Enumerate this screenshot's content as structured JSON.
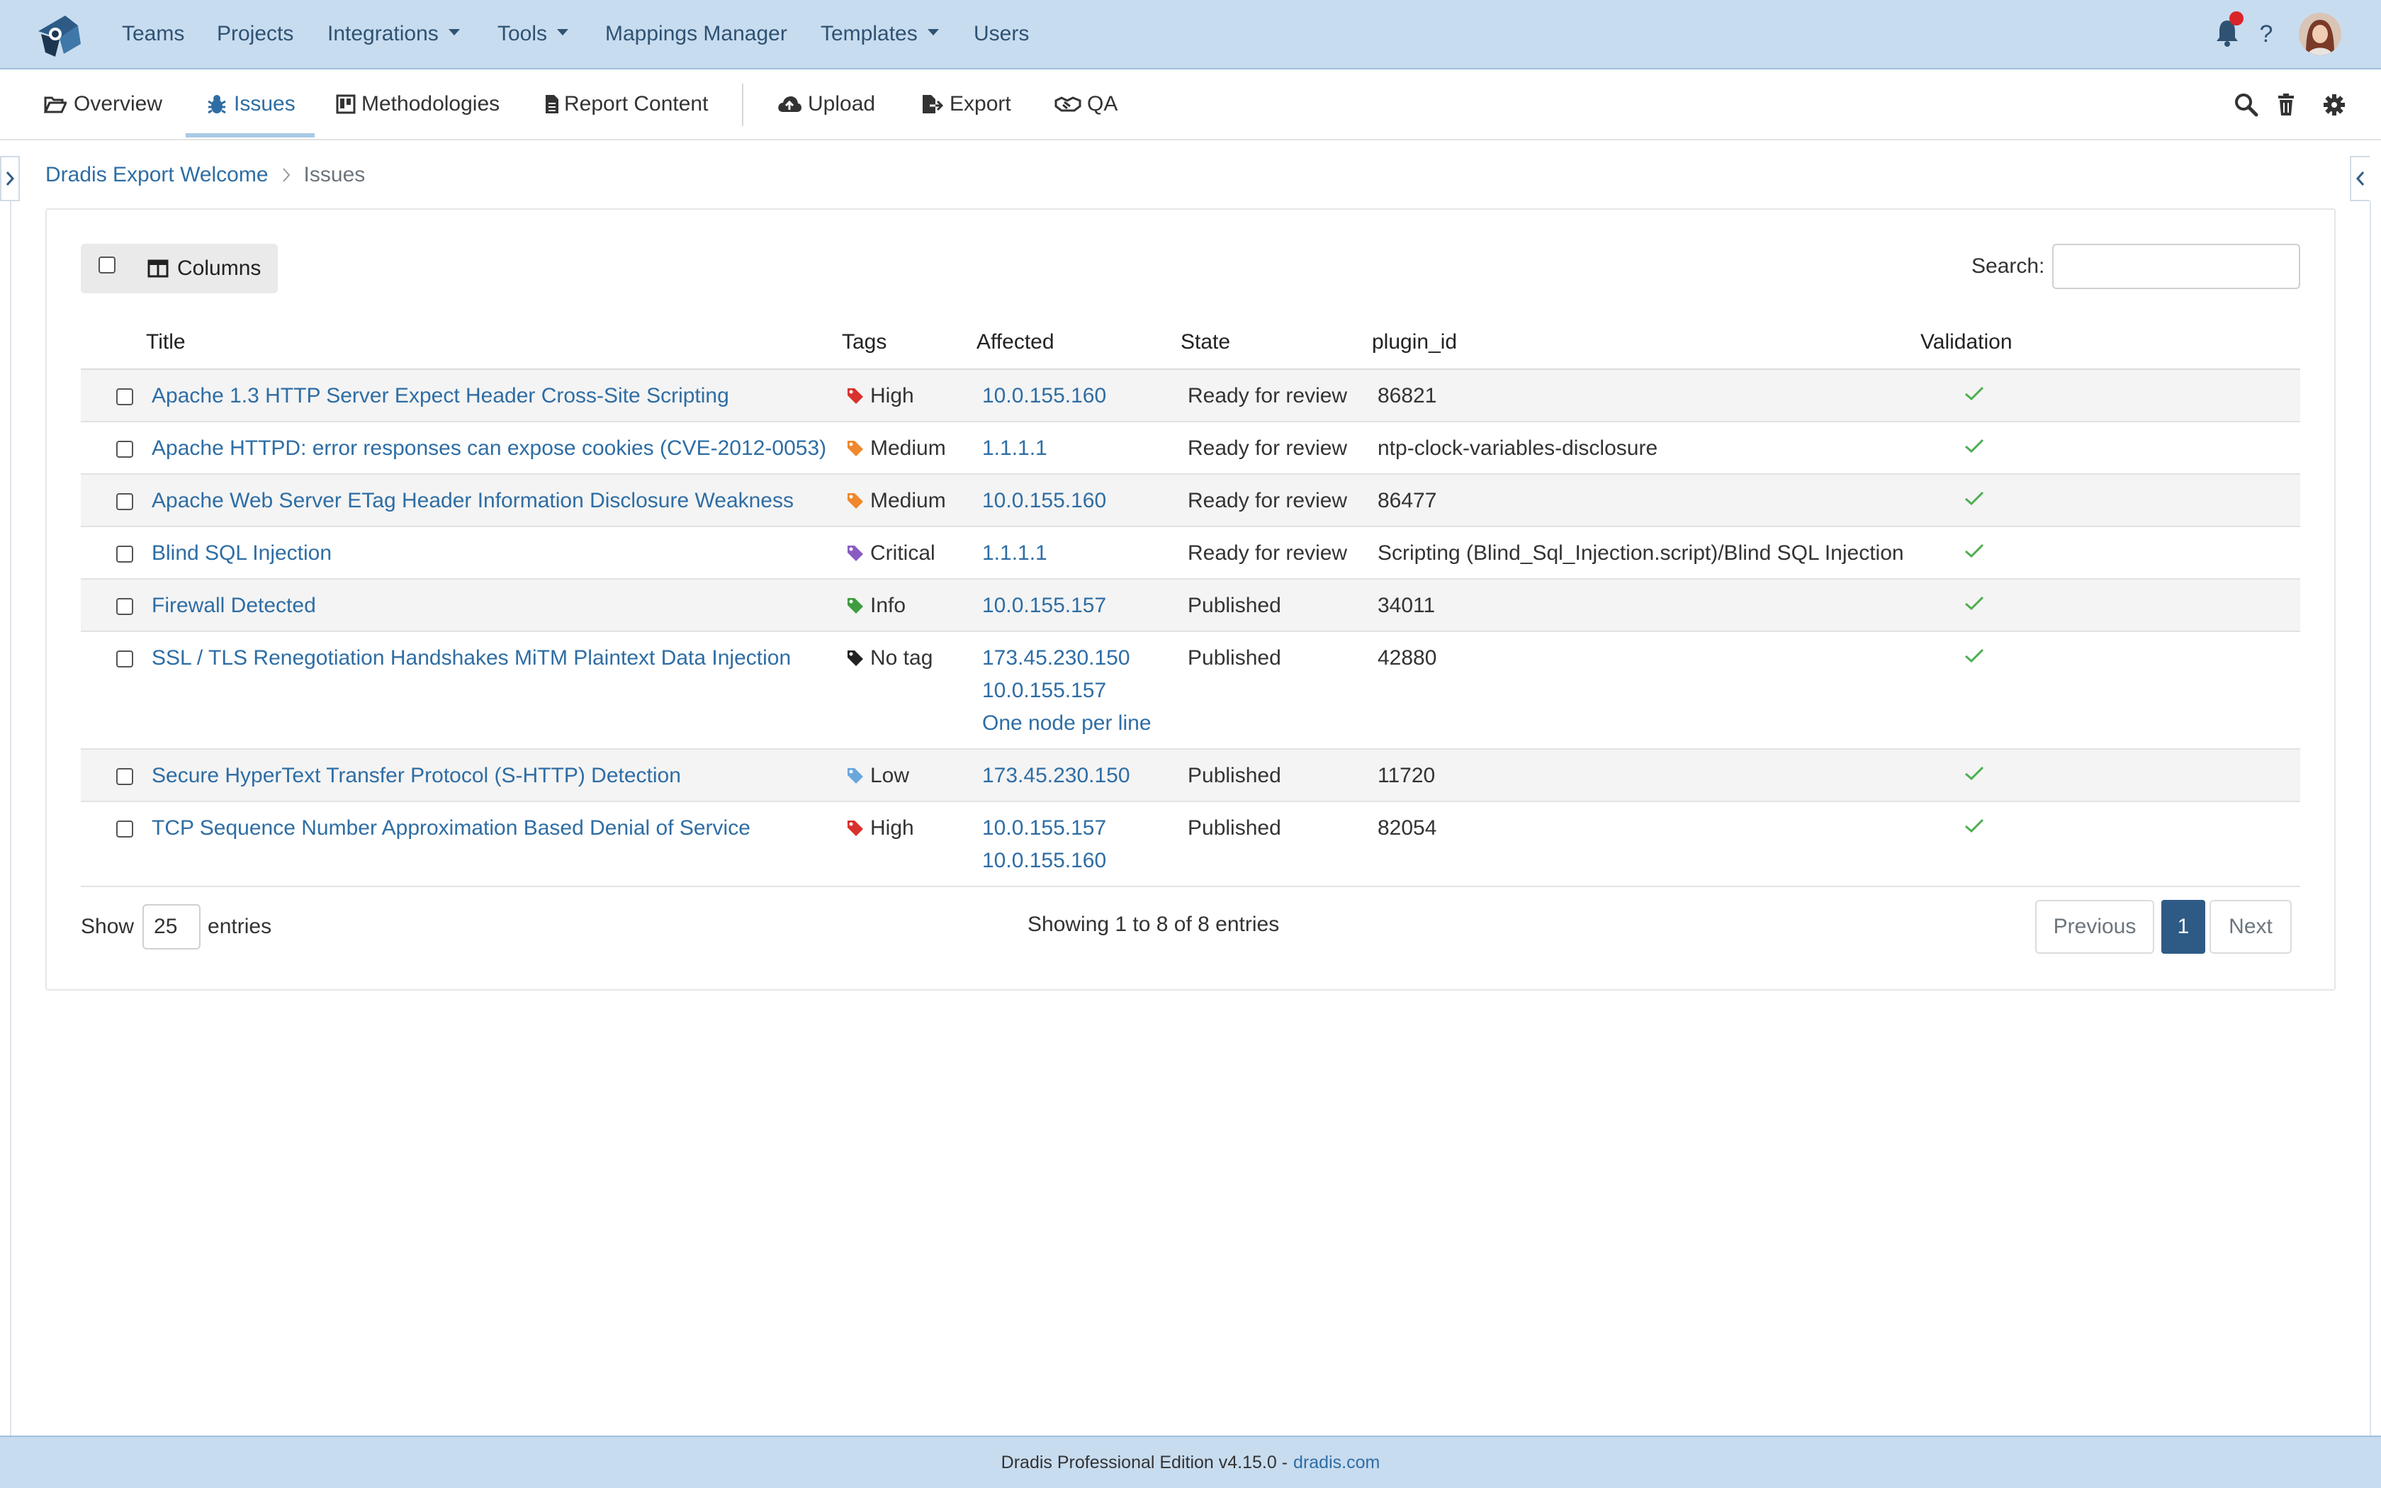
{
  "topnav": {
    "items": [
      {
        "label": "Teams",
        "dropdown": false
      },
      {
        "label": "Projects",
        "dropdown": false
      },
      {
        "label": "Integrations",
        "dropdown": true
      },
      {
        "label": "Tools",
        "dropdown": true
      },
      {
        "label": "Mappings Manager",
        "dropdown": false
      },
      {
        "label": "Templates",
        "dropdown": true
      },
      {
        "label": "Users",
        "dropdown": false
      }
    ],
    "help": "?",
    "icons": [
      "logo-icon",
      "bell-icon",
      "help-icon",
      "avatar"
    ],
    "notification_color": "#d9252a"
  },
  "subnav": {
    "tabs": [
      {
        "label": "Overview",
        "icon": "folder-open-icon"
      },
      {
        "label": "Issues",
        "icon": "bug-icon",
        "active": true
      },
      {
        "label": "Methodologies",
        "icon": "board-icon"
      },
      {
        "label": "Report Content",
        "icon": "document-icon"
      },
      {
        "label": "Upload",
        "icon": "cloud-upload-icon"
      },
      {
        "label": "Export",
        "icon": "file-export-icon"
      },
      {
        "label": "QA",
        "icon": "handshake-icon"
      }
    ],
    "tools": [
      "search-icon",
      "trash-icon",
      "gear-icon"
    ]
  },
  "breadcrumb": {
    "project": "Dradis Export Welcome",
    "current": "Issues"
  },
  "toolbar": {
    "columns_label": "Columns",
    "search_label": "Search:",
    "search_value": ""
  },
  "table": {
    "headers": {
      "title": "Title",
      "tags": "Tags",
      "affected": "Affected",
      "state": "State",
      "plugin_id": "plugin_id",
      "validation": "Validation"
    },
    "rows": [
      {
        "title": "Apache 1.3 HTTP Server Expect Header Cross-Site Scripting",
        "tag": "High",
        "tag_color": "#d9322e",
        "affected": [
          "10.0.155.160"
        ],
        "state": "Ready for review",
        "plugin_id": "86821",
        "validated": true
      },
      {
        "title": "Apache HTTPD: error responses can expose cookies (CVE-2012-0053)",
        "tag": "Medium",
        "tag_color": "#f0882c",
        "affected": [
          "1.1.1.1"
        ],
        "state": "Ready for review",
        "plugin_id": "ntp-clock-variables-disclosure",
        "validated": true
      },
      {
        "title": "Apache Web Server ETag Header Information Disclosure Weakness",
        "tag": "Medium",
        "tag_color": "#f0882c",
        "affected": [
          "10.0.155.160"
        ],
        "state": "Ready for review",
        "plugin_id": "86477",
        "validated": true
      },
      {
        "title": "Blind SQL Injection",
        "tag": "Critical",
        "tag_color": "#8a5cc2",
        "affected": [
          "1.1.1.1"
        ],
        "state": "Ready for review",
        "plugin_id": "Scripting (Blind_Sql_Injection.script)/Blind SQL Injection",
        "validated": true
      },
      {
        "title": "Firewall Detected",
        "tag": "Info",
        "tag_color": "#3e9d3e",
        "affected": [
          "10.0.155.157"
        ],
        "state": "Published",
        "plugin_id": "34011",
        "validated": true
      },
      {
        "title": "SSL / TLS Renegotiation Handshakes MiTM Plaintext Data Injection",
        "tag": "No tag",
        "tag_color": "#222222",
        "affected": [
          "173.45.230.150",
          "10.0.155.157",
          "One node per line"
        ],
        "state": "Published",
        "plugin_id": "42880",
        "validated": true
      },
      {
        "title": "Secure HyperText Transfer Protocol (S-HTTP) Detection",
        "tag": "Low",
        "tag_color": "#6aa7dc",
        "affected": [
          "173.45.230.150"
        ],
        "state": "Published",
        "plugin_id": "11720",
        "validated": true
      },
      {
        "title": "TCP Sequence Number Approximation Based Denial of Service",
        "tag": "High",
        "tag_color": "#d9322e",
        "affected": [
          "10.0.155.157",
          "10.0.155.160"
        ],
        "state": "Published",
        "plugin_id": "82054",
        "validated": true
      }
    ]
  },
  "length": {
    "show": "Show",
    "value": "25",
    "entries": "entries"
  },
  "info": "Showing 1 to 8 of 8 entries",
  "pagination": {
    "previous": "Previous",
    "page": "1",
    "next": "Next"
  },
  "footer": {
    "text": "Dradis Professional Edition v4.15.0 -",
    "link": "dradis.com"
  },
  "colors": {
    "accent": "#2e6da4",
    "navbar": "#c8dcef",
    "active_page": "#2d5b86",
    "check": "#4caf50"
  }
}
